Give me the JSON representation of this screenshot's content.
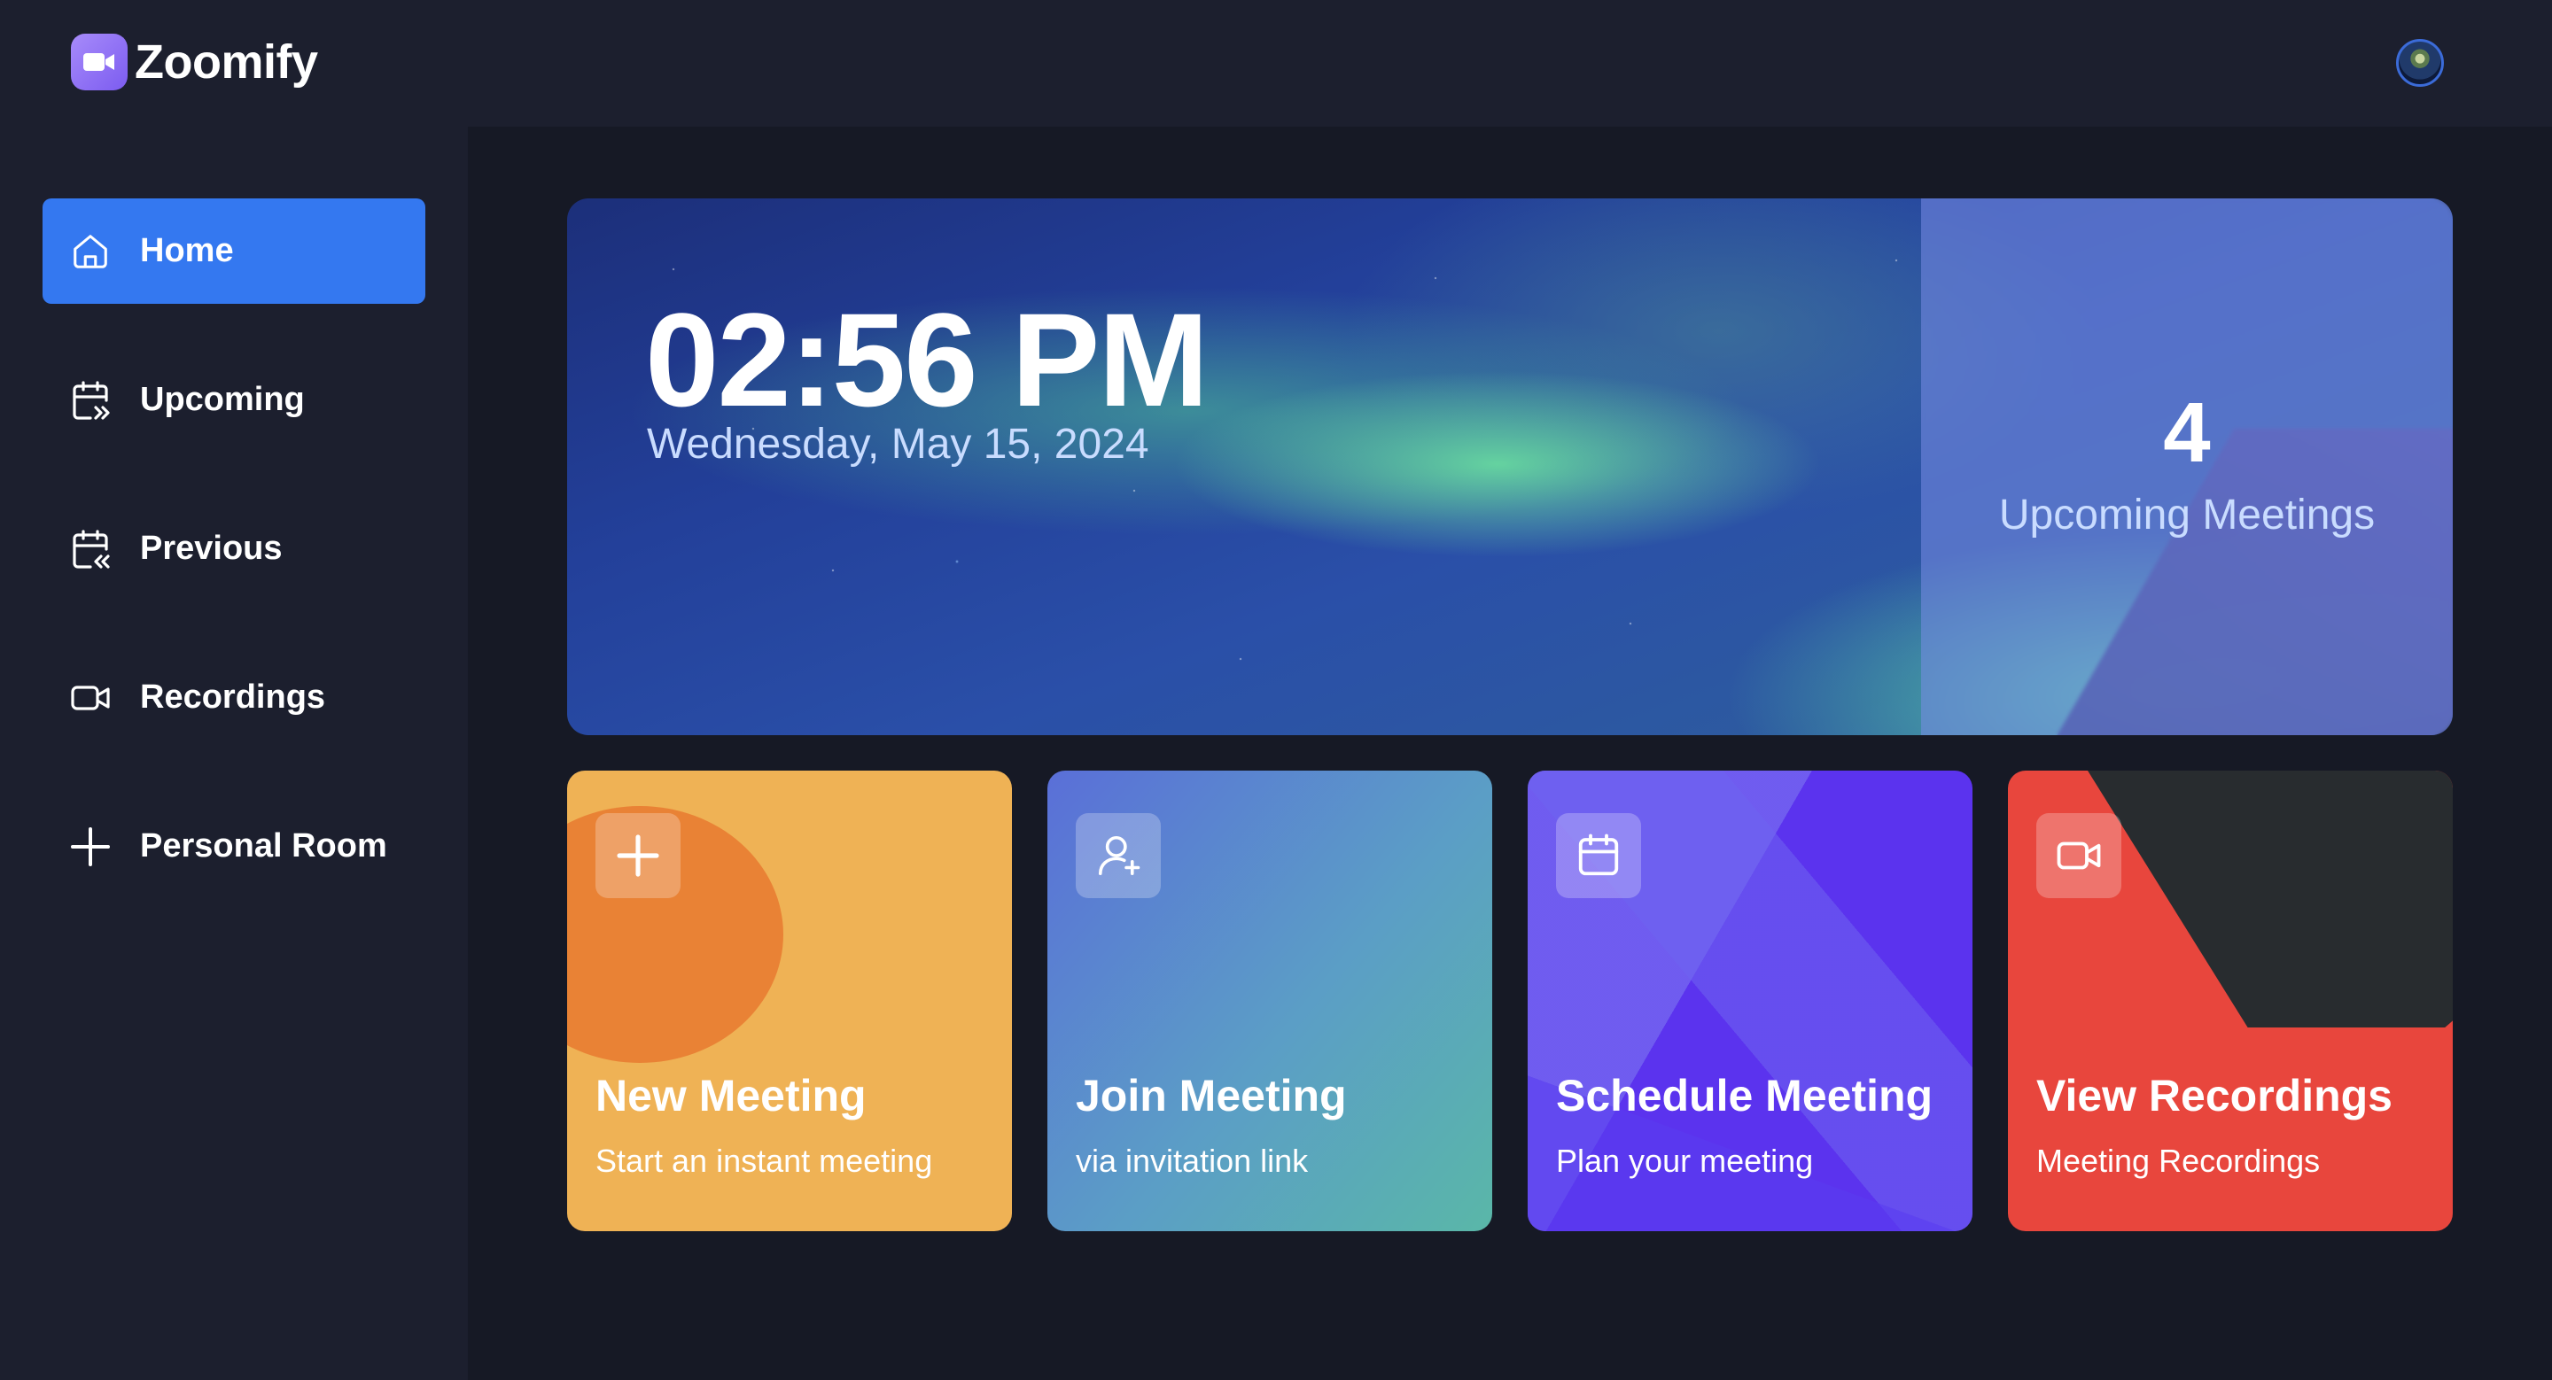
{
  "app": {
    "name": "Zoomify",
    "logo_icon": "video-camera-icon",
    "accent_color": "#3478f0",
    "background_color": "#1c1f2e"
  },
  "sidebar": {
    "items": [
      {
        "label": "Home",
        "icon": "home-icon",
        "active": true
      },
      {
        "label": "Upcoming",
        "icon": "calendar-forward-icon",
        "active": false
      },
      {
        "label": "Previous",
        "icon": "calendar-back-icon",
        "active": false
      },
      {
        "label": "Recordings",
        "icon": "video-icon",
        "active": false
      },
      {
        "label": "Personal Room",
        "icon": "plus-icon",
        "active": false
      }
    ]
  },
  "hero": {
    "time": "02:56 PM",
    "date": "Wednesday, May 15, 2024",
    "upcoming_count": "4",
    "upcoming_label": "Upcoming Meetings"
  },
  "cards": [
    {
      "title": "New Meeting",
      "subtitle": "Start an instant meeting",
      "icon": "plus-icon",
      "color": "#efb255"
    },
    {
      "title": "Join Meeting",
      "subtitle": "via invitation link",
      "icon": "user-plus-icon",
      "color": "#5b8ed0"
    },
    {
      "title": "Schedule Meeting",
      "subtitle": "Plan your meeting",
      "icon": "calendar-icon",
      "color": "#5b33ee"
    },
    {
      "title": "View Recordings",
      "subtitle": "Meeting Recordings",
      "icon": "video-icon",
      "color": "#e8463d"
    }
  ]
}
